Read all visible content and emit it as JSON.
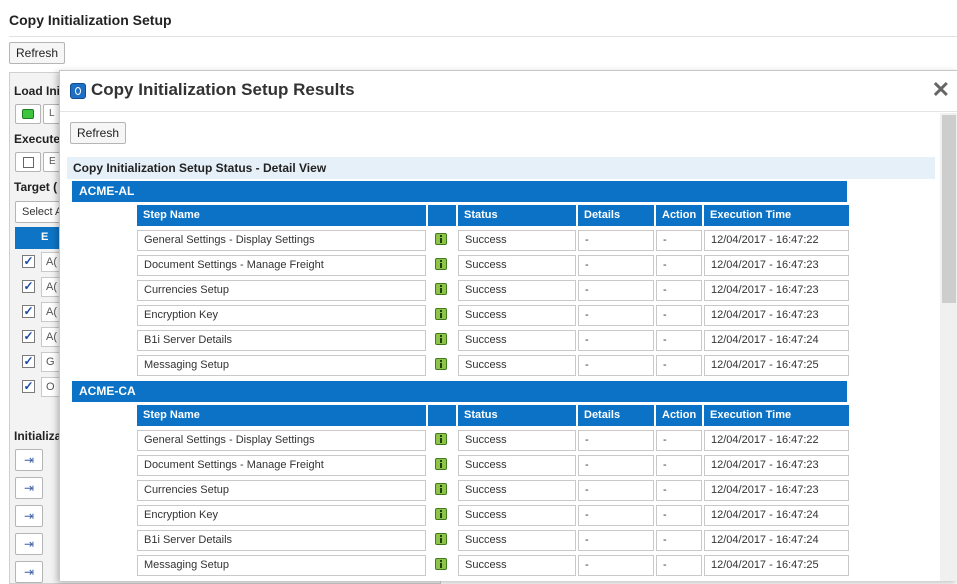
{
  "page": {
    "title": "Copy Initialization Setup",
    "refresh_label": "Refresh"
  },
  "background_panel": {
    "load_section": "Load Ini",
    "load_btn": "L",
    "execute_section": "Execute",
    "execute_btn": "E",
    "target_section": "Target (",
    "select_label": "Select A",
    "table_head": "E",
    "rows": [
      "A(",
      "A(",
      "A(",
      "A(",
      "G",
      "O"
    ],
    "init_section": "Initializa"
  },
  "modal": {
    "title": "Copy Initialization Setup Results",
    "refresh_label": "Refresh",
    "section_title": "Copy Initialization Setup Status - Detail View",
    "columns": {
      "step": "Step Name",
      "status": "Status",
      "details": "Details",
      "action": "Action",
      "time": "Execution Time"
    },
    "groups": [
      {
        "name": "ACME-AL",
        "rows": [
          {
            "step": "General Settings - Display Settings",
            "status": "Success",
            "details": "-",
            "action": "-",
            "time": "12/04/2017 - 16:47:22"
          },
          {
            "step": "Document Settings - Manage Freight",
            "status": "Success",
            "details": "-",
            "action": "-",
            "time": "12/04/2017 - 16:47:23"
          },
          {
            "step": "Currencies Setup",
            "status": "Success",
            "details": "-",
            "action": "-",
            "time": "12/04/2017 - 16:47:23"
          },
          {
            "step": "Encryption Key",
            "status": "Success",
            "details": "-",
            "action": "-",
            "time": "12/04/2017 - 16:47:23"
          },
          {
            "step": "B1i Server Details",
            "status": "Success",
            "details": "-",
            "action": "-",
            "time": "12/04/2017 - 16:47:24"
          },
          {
            "step": "Messaging Setup",
            "status": "Success",
            "details": "-",
            "action": "-",
            "time": "12/04/2017 - 16:47:25"
          }
        ]
      },
      {
        "name": "ACME-CA",
        "rows": [
          {
            "step": "General Settings - Display Settings",
            "status": "Success",
            "details": "-",
            "action": "-",
            "time": "12/04/2017 - 16:47:22"
          },
          {
            "step": "Document Settings - Manage Freight",
            "status": "Success",
            "details": "-",
            "action": "-",
            "time": "12/04/2017 - 16:47:23"
          },
          {
            "step": "Currencies Setup",
            "status": "Success",
            "details": "-",
            "action": "-",
            "time": "12/04/2017 - 16:47:23"
          },
          {
            "step": "Encryption Key",
            "status": "Success",
            "details": "-",
            "action": "-",
            "time": "12/04/2017 - 16:47:24"
          },
          {
            "step": "B1i Server Details",
            "status": "Success",
            "details": "-",
            "action": "-",
            "time": "12/04/2017 - 16:47:24"
          },
          {
            "step": "Messaging Setup",
            "status": "Success",
            "details": "-",
            "action": "-",
            "time": "12/04/2017 - 16:47:25"
          }
        ]
      }
    ]
  },
  "colors": {
    "header_blue": "#0b72c6",
    "section_bg": "#e6f0f8",
    "success_icon": "#8ec549"
  },
  "icons": {
    "modal": "info-circle-icon",
    "close": "close-icon",
    "row": "info-icon"
  }
}
